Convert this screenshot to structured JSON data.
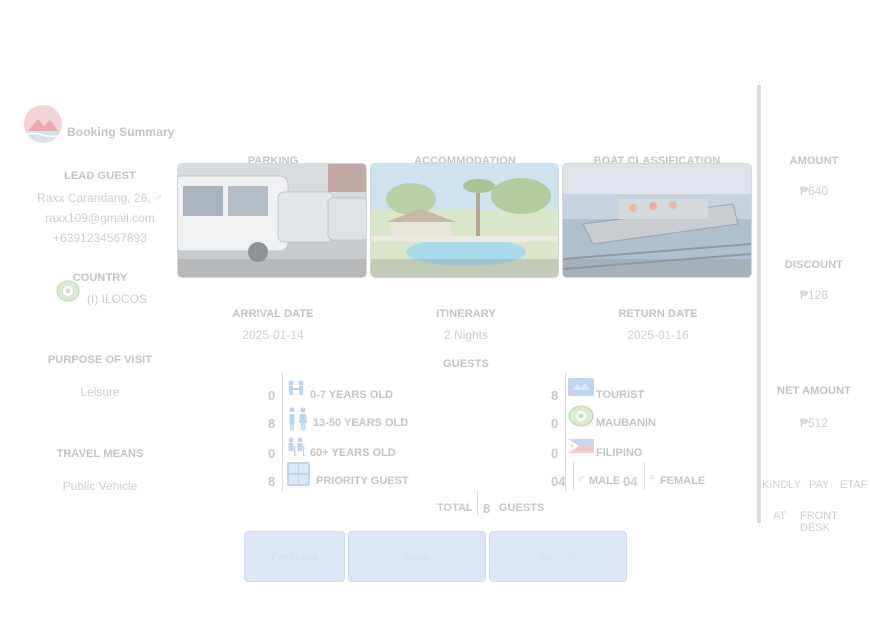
{
  "header": {
    "title": "Booking Summary"
  },
  "lead_guest": {
    "heading": "LEAD GUEST",
    "name_line": "Raxx Carandang, 26, ♂",
    "email": "raxx109@gmail.com",
    "phone": "+6391234567893"
  },
  "country": {
    "heading": "COUNTRY",
    "value": "(I) ILOCOS"
  },
  "purpose": {
    "heading": "PURPOSE OF VISIT",
    "value": "Leisure"
  },
  "travel": {
    "heading": "TRAVEL MEANS",
    "value": "Public Vehicle"
  },
  "cards": [
    {
      "label": "PARKING"
    },
    {
      "label": "ACCOMMODATION"
    },
    {
      "label": "BOAT CLASSIFICATION"
    }
  ],
  "dates": {
    "arrival_heading": "ARRIVAL DATE",
    "arrival_value": "2025-01-14",
    "itinerary_heading": "ITINERARY",
    "itinerary_value": "2 Nights",
    "return_heading": "RETURN DATE",
    "return_value": "2025-01-16"
  },
  "guests": {
    "heading": "GUESTS",
    "age_groups": [
      {
        "count": "0",
        "label": "0-7 YEARS OLD"
      },
      {
        "count": "8",
        "label": "13-50 YEARS OLD"
      },
      {
        "count": "0",
        "label": "60+ YEARS OLD"
      },
      {
        "count": "8",
        "label": "PRIORITY GUEST"
      }
    ],
    "types": [
      {
        "count": "8",
        "label": "TOURIST"
      },
      {
        "count": "0",
        "label": "MAUBANIN"
      },
      {
        "count": "0",
        "label": "FILIPINO"
      }
    ],
    "male_count": "04",
    "male_label": "MALE",
    "female_count": "04",
    "female_label": "FEMALE",
    "total_label": "TOTAL",
    "total_count": "8",
    "total_suffix": "GUESTS"
  },
  "amounts": {
    "amount_heading": "AMOUNT",
    "amount_value": "₱640",
    "discount_heading": "DISCOUNT",
    "discount_value": "₱128",
    "net_heading": "NET AMOUNT",
    "net_value": "₱512",
    "note_words": [
      "KINDLY",
      "PAY",
      "ETAF",
      "AT",
      "FRONT DESK"
    ]
  },
  "buttons": {
    "previous": "Previous",
    "save": "Save",
    "submit": "Submit"
  },
  "colors": {
    "brand_red": "#e8a0a6",
    "button_bg": "#dde5f7",
    "muted_text": "#c4c4c4"
  }
}
